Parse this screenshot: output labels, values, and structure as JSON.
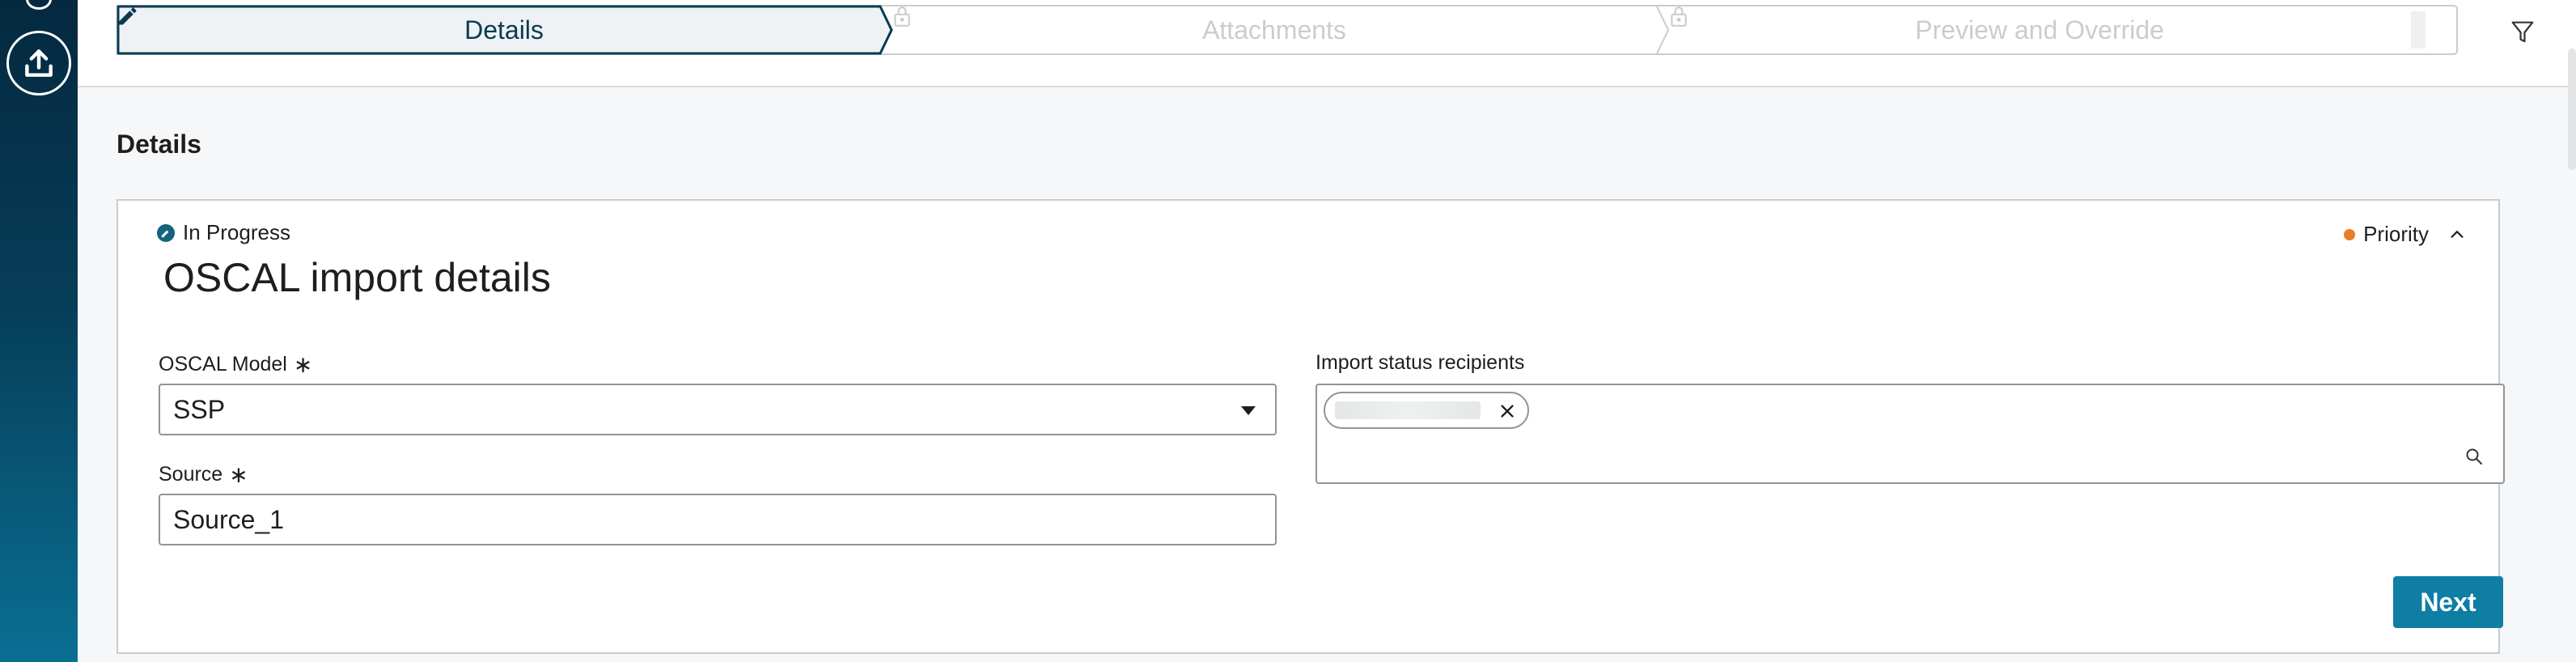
{
  "wizard": {
    "steps": [
      {
        "label": "Details",
        "state": "active",
        "icon": "pencil-icon"
      },
      {
        "label": "Attachments",
        "state": "locked",
        "icon": "lock-icon"
      },
      {
        "label": "Preview and Override",
        "state": "locked",
        "icon": "lock-icon"
      }
    ]
  },
  "toolbar": {
    "filter_icon": "filter-icon"
  },
  "rail": {
    "upload_icon": "upload-icon"
  },
  "page": {
    "section_title": "Details"
  },
  "card": {
    "status": "In Progress",
    "priority": "Priority",
    "title": "OSCAL import details",
    "fields": {
      "model_label": "OSCAL Model",
      "model_value": "SSP",
      "source_label": "Source",
      "source_value": "Source_1",
      "recipients_label": "Import status recipients",
      "required_mark": "∗"
    },
    "next_label": "Next"
  },
  "colors": {
    "accent": "#0f7ea5",
    "active_step": "#0b3a52",
    "priority_dot": "#e67e22",
    "rail_top": "#04293f",
    "rail_bottom": "#0a6f93"
  }
}
